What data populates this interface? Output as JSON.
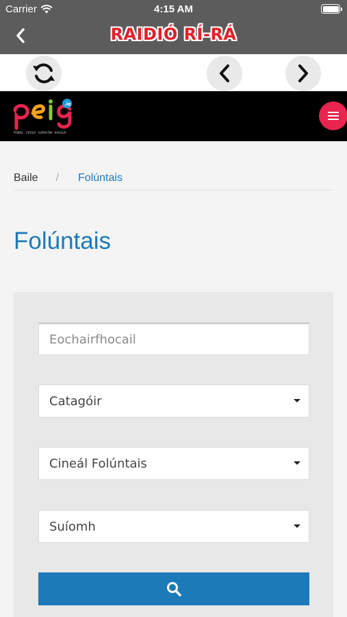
{
  "status_bar": {
    "carrier": "Carrier",
    "time": "4:15 AM"
  },
  "nav": {
    "title": "RAIDIÓ RÍ-RÁ",
    "back_icon": "chevron-left-icon"
  },
  "toolbar": {
    "refresh_icon": "refresh-icon",
    "back_icon": "chevron-left-icon",
    "forward_icon": "chevron-right-icon"
  },
  "site": {
    "logo": {
      "main": "peig",
      "suffix": ".ie",
      "tagline": "POBAL · CEOLO · ILIRACÓN · KAOLUS"
    },
    "menu_icon": "hamburger-icon",
    "accent": "#e8244f"
  },
  "breadcrumb": {
    "home": "Baile",
    "separator": "/",
    "current": "Folúntais"
  },
  "page": {
    "title": "Folúntais",
    "title_color": "#1c7ab9"
  },
  "filters": {
    "keyword": {
      "placeholder": "Eochairfhocail",
      "value": ""
    },
    "category": {
      "selected": "Catagóir"
    },
    "type": {
      "selected": "Cineál Folúntais"
    },
    "location": {
      "selected": "Suíomh"
    },
    "search_icon": "search-icon"
  }
}
